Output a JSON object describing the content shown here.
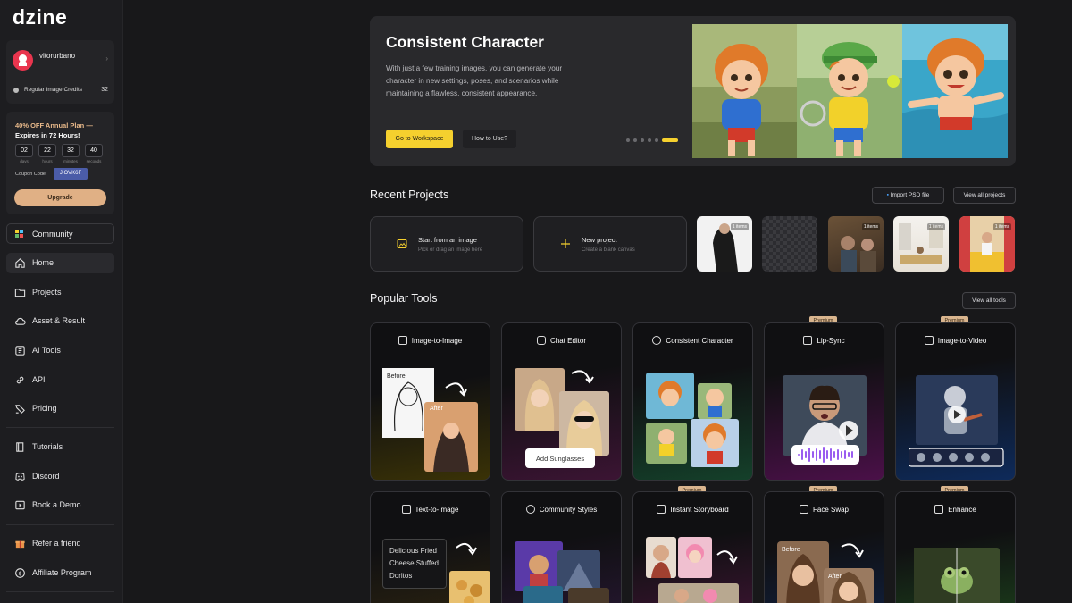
{
  "app": {
    "logo": "dzine"
  },
  "user": {
    "name": "vitorurbano",
    "credits_label": "Regular Image Credits",
    "credits_value": "32"
  },
  "promo": {
    "title_highlight": "40% OFF Annual Plan —",
    "title_rest": "Expires in 72 Hours!",
    "countdown": [
      {
        "value": "02",
        "label": "days"
      },
      {
        "value": "22",
        "label": "hours"
      },
      {
        "value": "32",
        "label": "minutes"
      },
      {
        "value": "40",
        "label": "seconds"
      }
    ],
    "coupon_label": "Coupon Code:",
    "coupon_code": "JIOVK6F",
    "upgrade_label": "Upgrade"
  },
  "sidebar": {
    "community": "Community",
    "items": [
      {
        "label": "Home",
        "icon": "home-icon"
      },
      {
        "label": "Projects",
        "icon": "folder-icon"
      },
      {
        "label": "Asset & Result",
        "icon": "cloud-icon"
      },
      {
        "label": "AI Tools",
        "icon": "tools-icon"
      },
      {
        "label": "API",
        "icon": "link-icon"
      },
      {
        "label": "Pricing",
        "icon": "tag-icon"
      },
      {
        "label": "Tutorials",
        "icon": "book-icon"
      },
      {
        "label": "Discord",
        "icon": "discord-icon"
      },
      {
        "label": "Book a Demo",
        "icon": "play-box-icon"
      },
      {
        "label": "Refer a friend",
        "icon": "gift-icon"
      },
      {
        "label": "Affiliate Program",
        "icon": "dollar-icon"
      }
    ]
  },
  "hero": {
    "title": "Consistent Character",
    "description": "With just a few training images, you can generate your character in new settings, poses, and scenarios while maintaining a flawless, consistent appearance.",
    "primary_button": "Go to Workspace",
    "secondary_button": "How to Use?"
  },
  "recent": {
    "title": "Recent Projects",
    "import_label": "Import PSD file",
    "view_all": "View all projects",
    "start_title": "Start from an image",
    "start_sub": "Pick or drag an image here",
    "new_title": "New project",
    "new_sub": "Create a blank canvas",
    "thumb_count": "1 items"
  },
  "tools": {
    "title": "Popular Tools",
    "view_all": "View all tools",
    "premium_label": "Premium",
    "items": [
      {
        "label": "Image-to-Image",
        "before": "Before",
        "after": "After"
      },
      {
        "label": "Chat Editor",
        "bubble": "Add Sunglasses"
      },
      {
        "label": "Consistent Character"
      },
      {
        "label": "Lip-Sync"
      },
      {
        "label": "Image-to-Video"
      },
      {
        "label": "Text-to-Image",
        "prompt": "Delicious Fried Cheese Stuffed Doritos"
      },
      {
        "label": "Community Styles"
      },
      {
        "label": "Instant Storyboard"
      },
      {
        "label": "Face Swap",
        "before": "Before",
        "after": "After"
      },
      {
        "label": "Enhance"
      }
    ]
  },
  "colors": {
    "accent": "#f5d02e",
    "premium": "#d9b58e",
    "coupon": "#4b5ca8",
    "avatar": "#e9354e"
  }
}
